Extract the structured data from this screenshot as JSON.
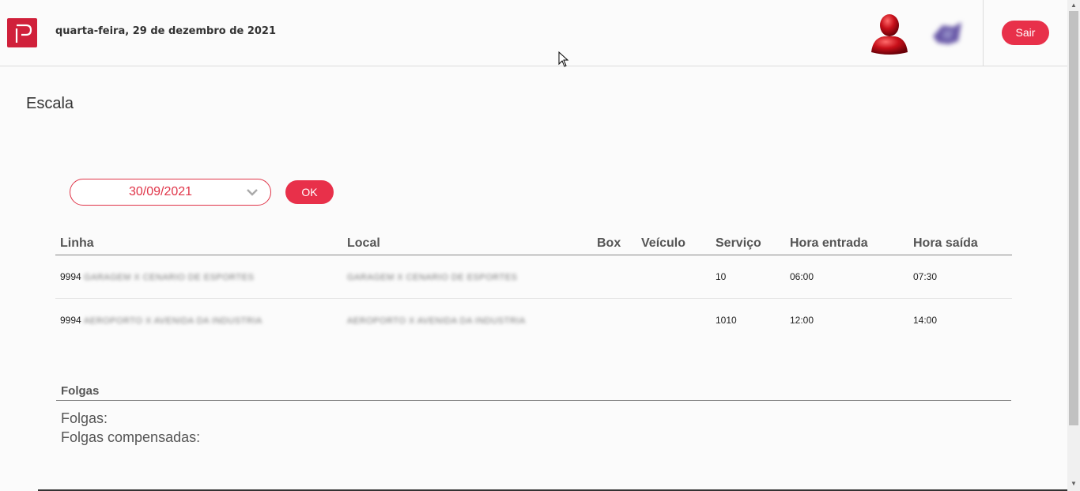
{
  "header": {
    "date": "quarta-feira, 29 de dezembro de 2021",
    "logout_label": "Sair",
    "brand_color": "#d0203a",
    "icons": [
      "logo-icon",
      "user-avatar-icon",
      "company-logo-icon"
    ]
  },
  "page": {
    "title": "Escala"
  },
  "filter": {
    "date_value": "30/09/2021",
    "ok_label": "OK"
  },
  "table": {
    "columns": [
      "Linha",
      "Local",
      "Box",
      "Veículo",
      "Serviço",
      "Hora entrada",
      "Hora saída"
    ],
    "rows": [
      {
        "linha_num": "9994",
        "linha_name": "GARAGEM X CENARIO DE ESPORTES",
        "local": "GARAGEM X CENARIO DE ESPORTES",
        "box": "",
        "veiculo": "",
        "servico": "10",
        "entrada": "06:00",
        "saida": "07:30"
      },
      {
        "linha_num": "9994",
        "linha_name": "AEROPORTO X AVENIDA DA INDUSTRIA",
        "local": "AEROPORTO X AVENIDA DA INDUSTRIA",
        "box": "",
        "veiculo": "",
        "servico": "1010",
        "entrada": "12:00",
        "saida": "14:00"
      }
    ]
  },
  "folgas": {
    "heading": "Folgas",
    "line1": "Folgas:",
    "line2": "Folgas compensadas:"
  }
}
